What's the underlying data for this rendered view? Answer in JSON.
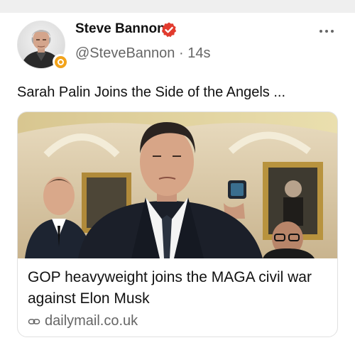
{
  "post": {
    "author": {
      "display_name": "Steve Bannon",
      "handle": "@SteveBannon",
      "separator": "·",
      "time": "14s",
      "verified_color": "#e23b2e"
    },
    "more_icon": "more-options-icon",
    "text": "Sarah Palin Joins the Side of the Angels ...",
    "link_card": {
      "title": "GOP heavyweight joins the MAGA civil war against Elon Musk",
      "domain": "dailymail.co.uk",
      "domain_icon": "link-icon"
    }
  },
  "colors": {
    "badge": "#f2a31b",
    "secondary_text": "#666666"
  }
}
